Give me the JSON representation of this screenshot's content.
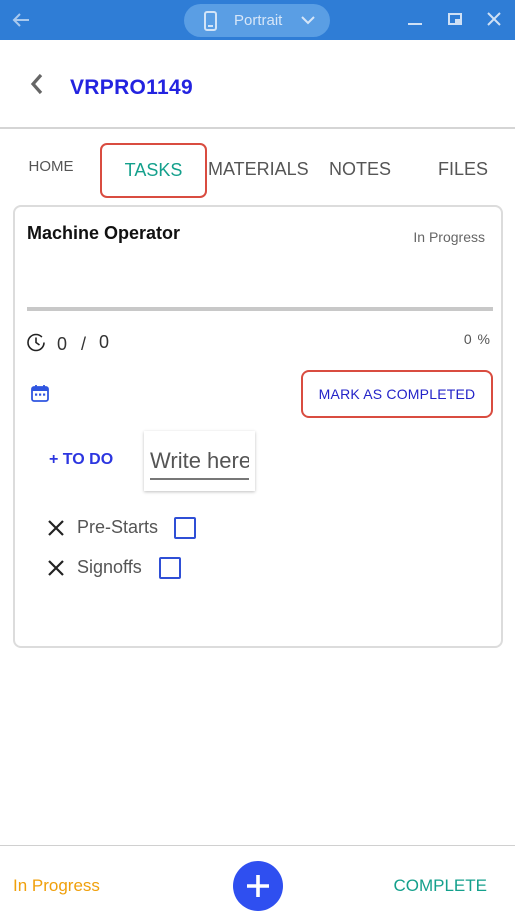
{
  "emulator": {
    "orientation_label": "Portrait",
    "bar_color": "#2f7dd6"
  },
  "header": {
    "title": "VRPRO1149",
    "title_color": "#2323e0"
  },
  "tabs": [
    {
      "label": "HOME",
      "selected": false
    },
    {
      "label": "TASKS",
      "selected": true
    },
    {
      "label": "MATERIALS",
      "selected": false
    },
    {
      "label": "NOTES",
      "selected": false
    },
    {
      "label": "FILES",
      "selected": false
    }
  ],
  "task": {
    "role": "Machine Operator",
    "status": "In Progress",
    "progress_fraction": 0,
    "time_done": "0",
    "time_separator": "/",
    "time_total": "0",
    "percent_label": "0 %",
    "mark_completed_label": "MARK AS COMPLETED",
    "todo_label": "+ TO DO",
    "todo_placeholder": "Write here",
    "checklist": [
      {
        "label": "Pre-Starts",
        "checked": false
      },
      {
        "label": "Signoffs",
        "checked": false
      }
    ]
  },
  "footer": {
    "status": "In Progress",
    "complete_label": "COMPLETE",
    "status_color": "#f0a00c",
    "accent_color": "#14a08c",
    "fab_color": "#2f4ff0"
  },
  "icons": {
    "emulator_back": "arrow-left-icon",
    "orientation": "phone-icon",
    "dropdown": "chevron-down-icon",
    "minimize": "minimize-icon",
    "restore": "restore-icon",
    "close": "close-icon",
    "back": "chevron-left-icon",
    "timer": "clock-icon",
    "date": "calendar-icon",
    "remove": "x-icon",
    "add": "plus-icon"
  }
}
